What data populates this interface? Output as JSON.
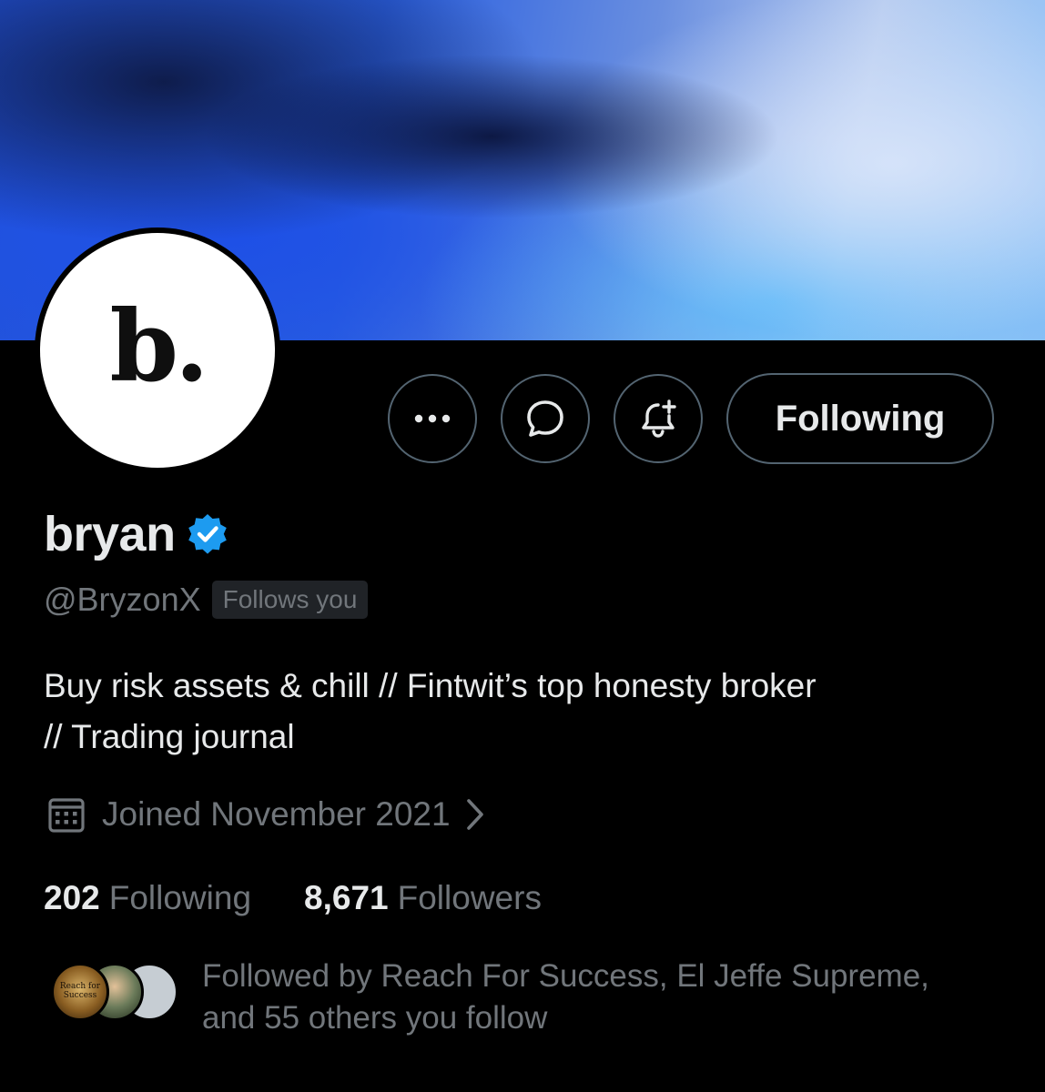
{
  "profile": {
    "avatar_letter": "b.",
    "display_name": "bryan",
    "handle": "@BryzonX",
    "follows_you_badge": "Follows you",
    "bio_line1": "Buy risk assets & chill // Fintwit’s top honesty broker",
    "bio_line2": "// Trading journal",
    "joined": "Joined November 2021"
  },
  "actions": {
    "more_icon": "ellipsis-icon",
    "message_icon": "message-bubble-icon",
    "notify_icon": "bell-plus-icon",
    "following_label": "Following"
  },
  "stats": {
    "following_count": "202",
    "following_label": "Following",
    "followers_count": "8,671",
    "followers_label": "Followers"
  },
  "followed_by": {
    "line1": "Followed by Reach For Success, El Jeffe Supreme,",
    "line2": "and 55 others you follow",
    "first_avatar_text": "Reach for Success"
  },
  "colors": {
    "background": "#000000",
    "primary_text": "#e7e9ea",
    "secondary_text": "#71767b",
    "border": "#536471",
    "verified_blue": "#1d9bf0"
  }
}
